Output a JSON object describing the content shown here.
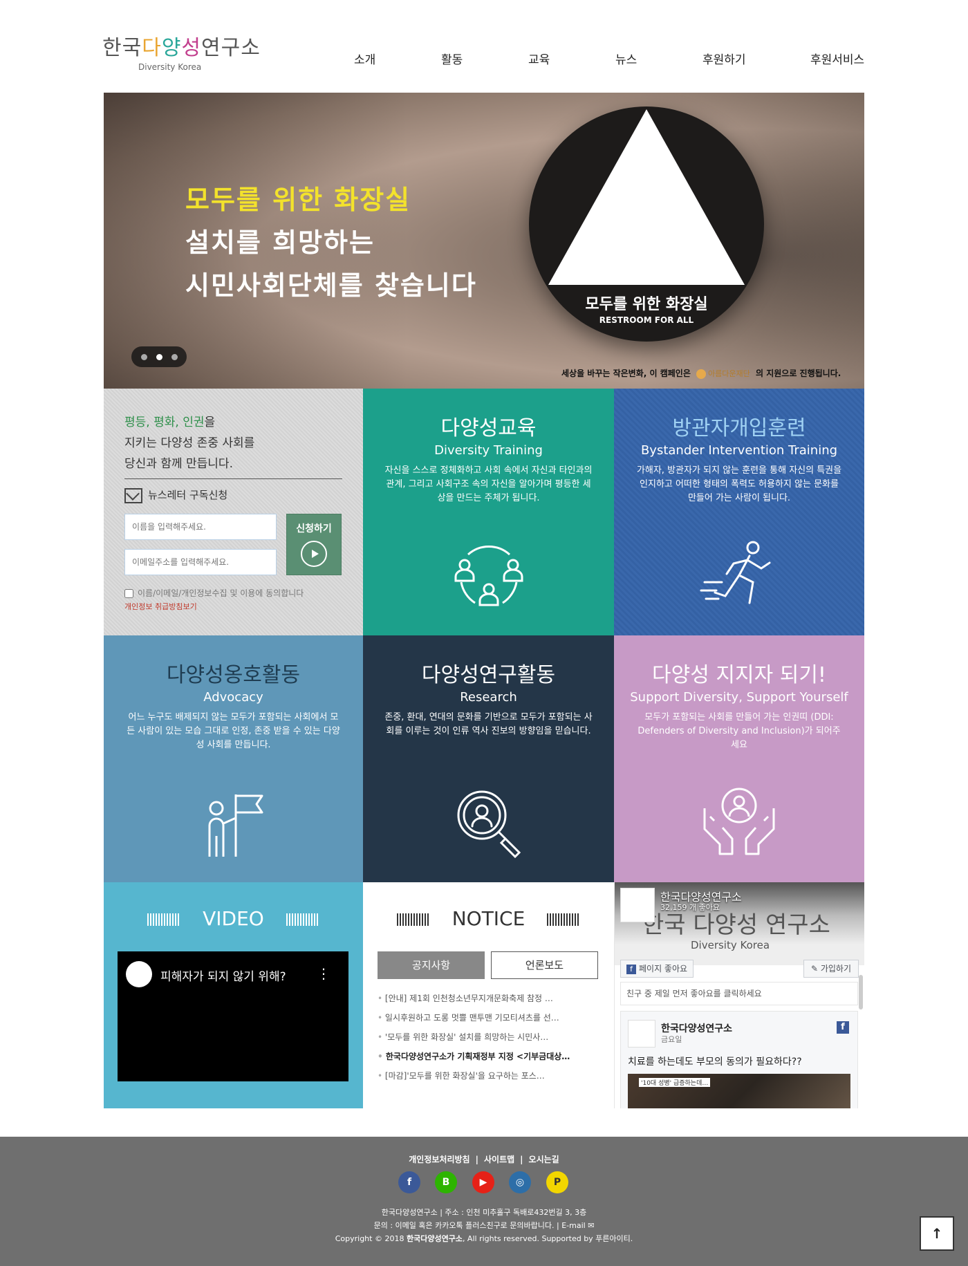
{
  "header": {
    "logo": {
      "prefix": "한국",
      "d1": "다",
      "d2": "양",
      "d3": "성",
      "suffix": "연구소",
      "sub": "Diversity Korea"
    },
    "nav": [
      "소개",
      "활동",
      "교육",
      "뉴스",
      "후원하기",
      "후원서비스"
    ]
  },
  "hero": {
    "line1": "모두를 위한 화장실",
    "line2": "설치를 희망하는",
    "line3": "시민사회단체를 찾습니다",
    "sign_title": "모두를 위한 화장실",
    "sign_sub": "RESTROOM FOR ALL",
    "caption_before": "세상을 바꾸는 작은변화, 이 캠페인은",
    "sponsor": "아름다운재단",
    "caption_after": "의 지원으로 진행됩니다.",
    "slides": 3,
    "active_slide": 2
  },
  "newsletter": {
    "slogan_hl1": "평등",
    "slogan_sep1": ", ",
    "slogan_hl2": "평화",
    "slogan_sep2": ", ",
    "slogan_hl3": "인권",
    "slogan_end1": "을",
    "slogan_line2": "지키는 다양성 존중 사회를",
    "slogan_line3": "당신과 함께 만듭니다.",
    "label": "뉴스레터 구독신청",
    "name_placeholder": "이름을 입력해주세요.",
    "email_placeholder": "이메일주소를 입력해주세요.",
    "submit": "신청하기",
    "agree": "이름/이메일/개인정보수집 및 이용에 동의합니다",
    "privacy_link": "개인정보 취급방침보기"
  },
  "tiles": {
    "education": {
      "title": "다양성교육",
      "sub": "Diversity Training",
      "desc": "자신을 스스로 정체화하고 사회 속에서 자신과 타인과의 관계, 그리고 사회구조 속의 자신을 알아가며 평등한 세상을 만드는 주체가 됩니다."
    },
    "bystander": {
      "title": "방관자개입훈련",
      "sub": "Bystander Intervention Training",
      "desc": "가해자, 방관자가 되지 않는 훈련을 통해 자신의 특권을 인지하고 어떠한 형태의 폭력도 허용하지 않는 문화를 만들어 가는 사람이 됩니다."
    },
    "advocacy": {
      "title": "다양성옹호활동",
      "sub": "Advocacy",
      "desc": "어느 누구도 배제되지 않는 모두가 포함되는 사회에서 모든 사람이 있는 모습 그대로 인정, 존중 받을 수 있는 다양성 사회를 만듭니다."
    },
    "research": {
      "title": "다양성연구활동",
      "sub": "Research",
      "desc": "존중, 환대, 연대의 문화를 기반으로 모두가 포함되는 사회를 이루는 것이 인류 역사 진보의 방향임을 믿습니다."
    },
    "support": {
      "title": "다양성 지지자 되기!",
      "sub": "Support Diversity, Support Yourself",
      "desc": "모두가 포함되는 사회를 만들어 가는 인권띠 (DDI: Defenders of Diversity and Inclusion)가 되어주세요"
    }
  },
  "video": {
    "title": "VIDEO",
    "clip_title": "피해자가 되지 않기 위해?"
  },
  "notice": {
    "title": "NOTICE",
    "tab_active": "공지사항",
    "tab_other": "언론보도",
    "items": [
      "[안내] 제1회 인천청소년무지개문화축제 참정 …",
      "일시후원하고 도롱 멋쁠 맨투맨 기모티셔츠를 선…",
      "'모두를 위한 화장실' 설치를 희망하는 시민사…",
      "한국다양성연구소가 기획재정부 지정 <기부금대상…",
      "[마감]'모두를 위한 화장실'을 요구하는 포스…"
    ]
  },
  "facebook": {
    "page_name": "한국다양성연구소",
    "likes": "32,159 개 좋아요",
    "cover_logo": "한국 다양성 연구소",
    "cover_sub": "Diversity Korea",
    "like_btn": "페이지 좋아요",
    "join_btn": "가입하기",
    "friend_text": "친구 중 제일 먼저 좋아요를 클릭하세요",
    "post_name": "한국다양성연구소",
    "post_day": "금요일",
    "post_text": "치료를 하는데도 부모의 동의가 필요하다??",
    "post_img_tag": "'10대 성병' 급증하는데…"
  },
  "footer": {
    "links": [
      "개인정보처리방침",
      "사이트맵",
      "오시는길"
    ],
    "sns": [
      "facebook-icon",
      "blog-icon",
      "youtube-icon",
      "instagram-icon",
      "kakaopage-icon"
    ],
    "sns_glyphs": [
      "f",
      "B",
      "▶",
      "◎",
      "P"
    ],
    "info_line1": "한국다양성연구소   |   주소 : 인천 미추홀구 독배로432번길 3, 3층",
    "info_line2": "문의 : 이메일 혹은 카카오톡 플러스친구로 문의바랍니다.   |   E-mail ✉",
    "info_line3_pre": "Copyright © 2018",
    "info_line3_org": "한국다양성연구소",
    "info_line3_post": ", All rights reserved. Supported by 푸른아이티.",
    "top_btn": "↑"
  }
}
